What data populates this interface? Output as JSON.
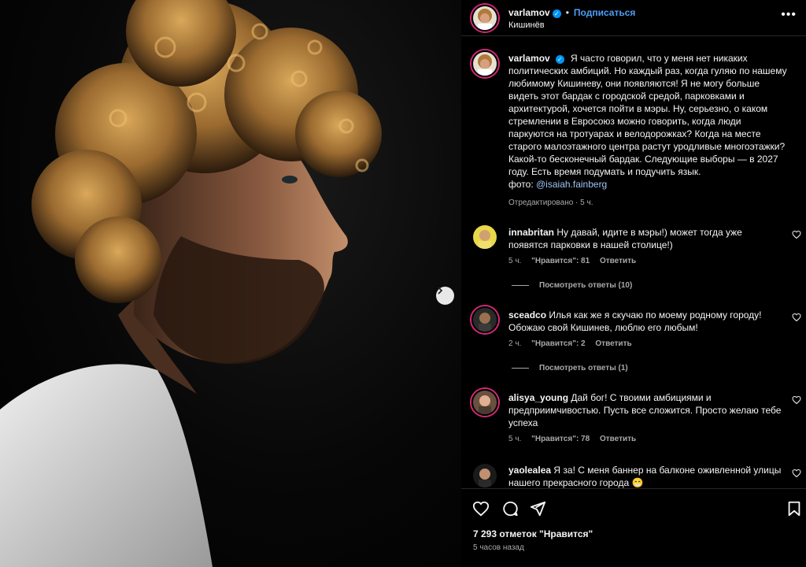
{
  "post": {
    "author": "varlamov",
    "follow_label": "Подписаться",
    "separator": "•",
    "location": "Кишинёв",
    "more_icon": "more-horizontal-icon",
    "caption_author": "varlamov",
    "caption_text": "Я часто говорил, что у меня нет никаких политических амбиций. Но каждый раз, когда гуляю по нашему любимому Кишиневу, они появляются! Я не могу больше видеть этот бардак с городской средой, парковками и архитектурой, хочется пойти в мэры. Ну, серьезно, о каком стремлении в Евросоюз можно говорить, когда люди паркуются на тротуарах и велодорожках? Когда на месте старого малоэтажного центра растут уродливые многоэтажки? Какой-то бесконечный бардак. Следующие выборы — в 2027 году. Есть время подумать и подучить язык.",
    "photo_credit_prefix": "фото:",
    "photo_credit_mention": "@isaiah.fainberg",
    "edited_meta": "Отредактировано · 5 ч.",
    "next_photo_icon": "chevron-right-icon"
  },
  "comments": [
    {
      "username": "innabritan",
      "text": "Ну давай, идите в мэры!) может тогда уже появятся парковки в нашей столице!)",
      "time": "5 ч.",
      "likes": "\"Нравится\": 81",
      "reply_label": "Ответить",
      "view_replies": "Посмотреть ответы (10)"
    },
    {
      "username": "sceadco",
      "text": "Илья как же я скучаю по моему родному городу! Обожаю свой Кишинев, люблю его любым!",
      "time": "2 ч.",
      "likes": "\"Нравится\": 2",
      "reply_label": "Ответить",
      "view_replies": "Посмотреть ответы (1)"
    },
    {
      "username": "alisya_young",
      "text": "Дай бог! С твоими амбициями и предприимчивостью. Пусть все сложится. Просто желаю тебе успеха",
      "time": "5 ч.",
      "likes": "\"Нравится\": 78",
      "reply_label": "Ответить",
      "view_replies": ""
    },
    {
      "username": "yaolealea",
      "text": "Я за! С меня баннер на балконе оживленной улицы нашего прекрасного города 😁",
      "time": "",
      "likes": "",
      "reply_label": "",
      "view_replies": ""
    }
  ],
  "footer": {
    "likes_total": "7 293 отметок \"Нравится\"",
    "time_ago": "5 часов назад",
    "icons": [
      "heart-icon",
      "comment-icon",
      "share-icon",
      "bookmark-icon"
    ]
  },
  "colors": {
    "background": "#000000",
    "accent_link": "#4c9ff5",
    "verified_badge": "#0095f6",
    "muted_text": "#a8a8a8",
    "story_ring": "#d62976"
  }
}
